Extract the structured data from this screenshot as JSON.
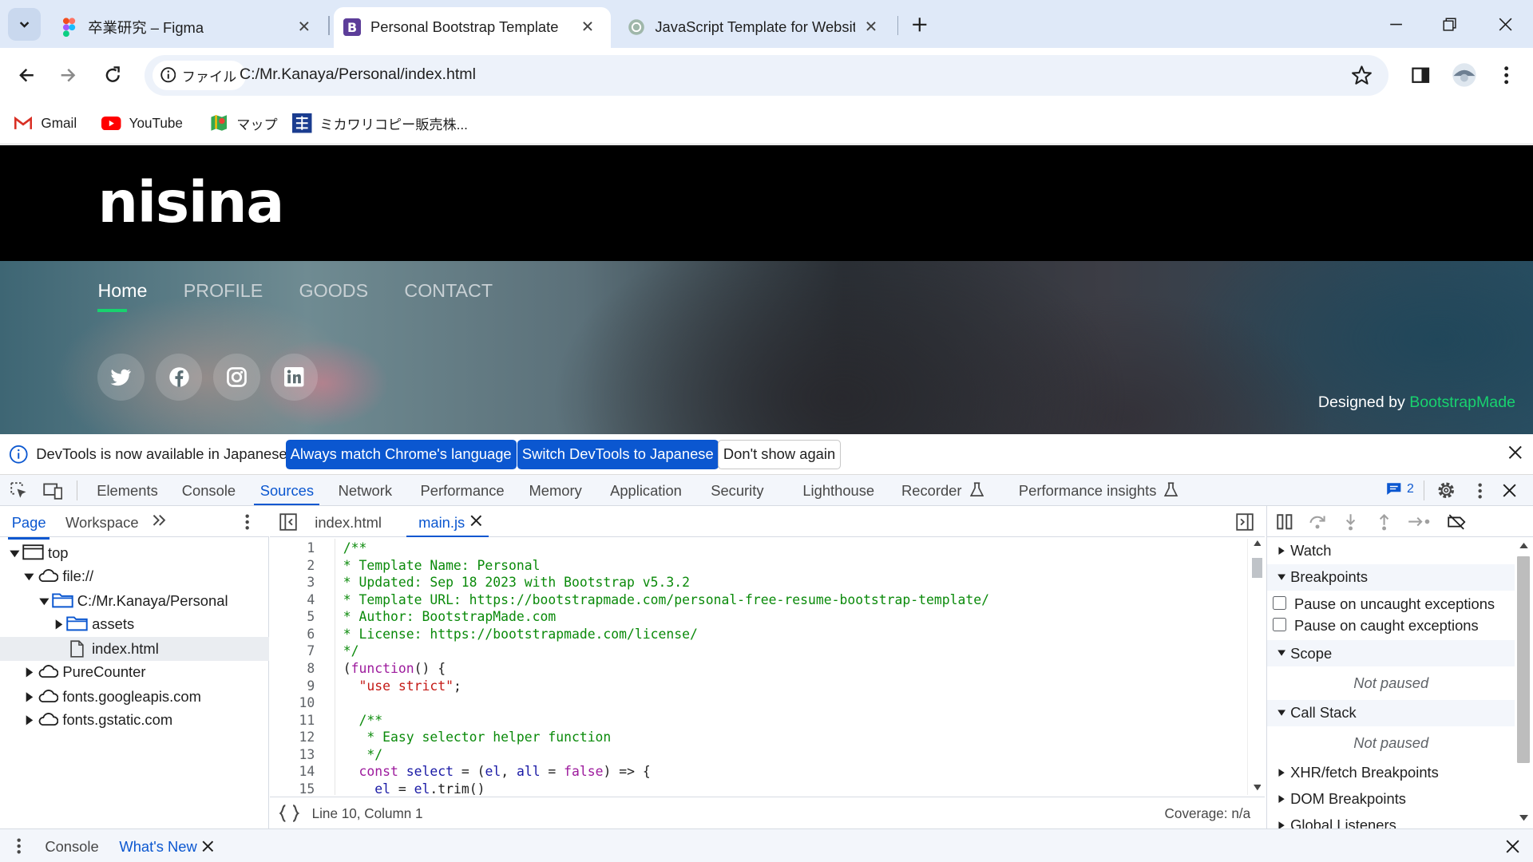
{
  "browser": {
    "tabs": [
      {
        "title": "卒業研究 – Figma",
        "favicon": "figma-icon"
      },
      {
        "title": "Personal Bootstrap Template",
        "favicon": "bootstrap-icon"
      },
      {
        "title": "JavaScript Template for Websit",
        "favicon": "chatgpt-icon"
      }
    ],
    "active_tab": 1,
    "address": {
      "chip_label": "ファイル",
      "url": "C:/Mr.Kanaya/Personal/index.html"
    },
    "bookmarks": [
      {
        "label": "Gmail",
        "icon": "gmail-icon"
      },
      {
        "label": "YouTube",
        "icon": "youtube-icon"
      },
      {
        "label": "マップ",
        "icon": "maps-icon"
      },
      {
        "label": "ミカワリコピー販売株...",
        "icon": "bookmark-site-icon"
      }
    ]
  },
  "site": {
    "logo": "nisina",
    "nav": [
      "Home",
      "PROFILE",
      "GOODS",
      "CONTACT"
    ],
    "social": [
      "twitter-icon",
      "facebook-icon",
      "instagram-icon",
      "linkedin-icon"
    ],
    "credits_prefix": "Designed by",
    "credits_link": "BootstrapMade",
    "accent": "#18d26e"
  },
  "devtools": {
    "infobar": {
      "message": "DevTools is now available in Japanese!",
      "buttons": [
        "Always match Chrome's language",
        "Switch DevTools to Japanese",
        "Don't show again"
      ]
    },
    "tabs": [
      "Elements",
      "Console",
      "Sources",
      "Network",
      "Performance",
      "Memory",
      "Application",
      "Security",
      "Lighthouse",
      "Recorder",
      "Performance insights"
    ],
    "active_tab": "Sources",
    "issues_count": "2",
    "navigator": {
      "tabs": [
        "Page",
        "Workspace"
      ],
      "tree": [
        {
          "label": "top"
        },
        {
          "label": "file://"
        },
        {
          "label": "C:/Mr.Kanaya/Personal"
        },
        {
          "label": "assets"
        },
        {
          "label": "index.html"
        },
        {
          "label": "PureCounter"
        },
        {
          "label": "fonts.googleapis.com"
        },
        {
          "label": "fonts.gstatic.com"
        }
      ]
    },
    "editor": {
      "tabs": [
        "index.html",
        "main.js"
      ],
      "active_tab": "main.js",
      "lines": [
        "/**",
        "* Template Name: Personal",
        "* Updated: Sep 18 2023 with Bootstrap v5.3.2",
        "* Template URL: https://bootstrapmade.com/personal-free-resume-bootstrap-template/",
        "* Author: BootstrapMade.com",
        "* License: https://bootstrapmade.com/license/",
        "*/",
        "(function() {",
        "  \"use strict\";",
        "",
        "  /**",
        "   * Easy selector helper function",
        "   */",
        "  const select = (el, all = false) => {",
        "    el = el.trim()"
      ],
      "status_position": "Line 10, Column 1",
      "coverage": "Coverage: n/a"
    },
    "debugger": {
      "sections": [
        "Watch",
        "Breakpoints",
        "Scope",
        "Call Stack",
        "XHR/fetch Breakpoints",
        "DOM Breakpoints",
        "Global Listeners"
      ],
      "checkboxes": [
        "Pause on uncaught exceptions",
        "Pause on caught exceptions"
      ],
      "not_paused": "Not paused"
    },
    "drawer": {
      "tabs": [
        "Console",
        "What's New"
      ],
      "active_tab": "What's New"
    }
  }
}
